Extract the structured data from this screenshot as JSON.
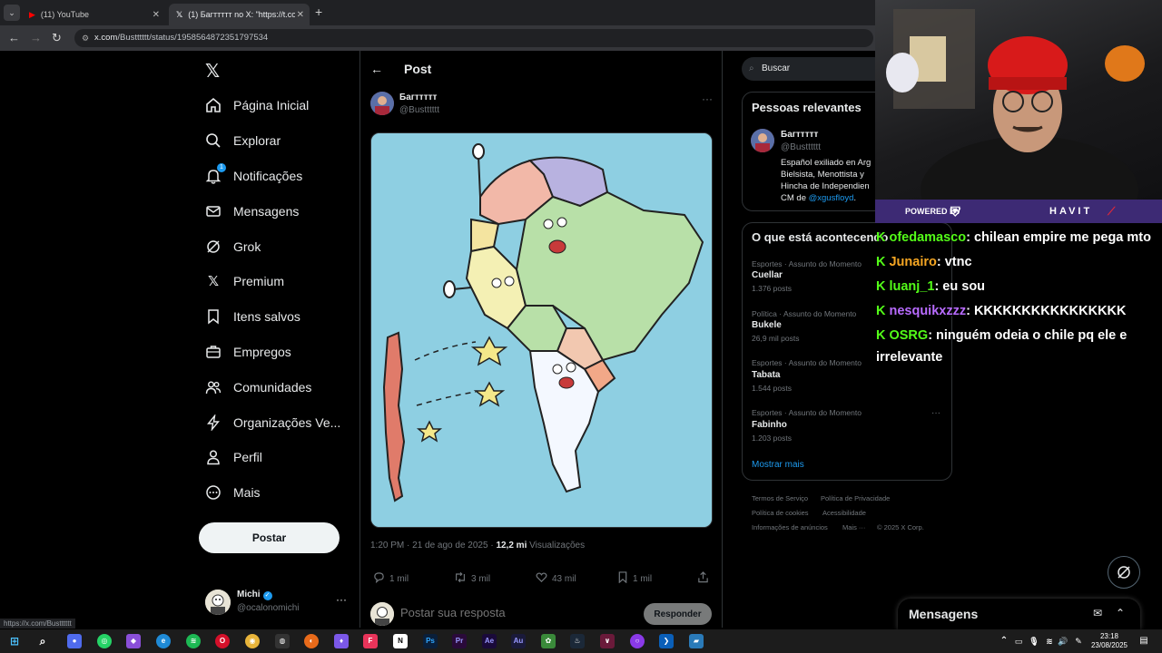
{
  "browser": {
    "tabs": [
      {
        "label": "(11) YouTube"
      },
      {
        "label": "(1) Багттттт no X: \"https://t.co/a"
      }
    ],
    "url_domain": "x.com",
    "url_path": "/Bustttttt/status/1958564872351797534",
    "status_url": "https://x.com/Bustttttt"
  },
  "nav": {
    "items": [
      {
        "label": "Página Inicial",
        "icon": "home-icon"
      },
      {
        "label": "Explorar",
        "icon": "search-icon"
      },
      {
        "label": "Notificações",
        "icon": "bell-icon",
        "badge": "1"
      },
      {
        "label": "Mensagens",
        "icon": "mail-icon"
      },
      {
        "label": "Grok",
        "icon": "grok-icon"
      },
      {
        "label": "Premium",
        "icon": "x-icon"
      },
      {
        "label": "Itens salvos",
        "icon": "bookmark-icon"
      },
      {
        "label": "Empregos",
        "icon": "briefcase-icon"
      },
      {
        "label": "Comunidades",
        "icon": "people-icon"
      },
      {
        "label": "Organizações Ve...",
        "icon": "bolt-icon"
      },
      {
        "label": "Perfil",
        "icon": "person-icon"
      },
      {
        "label": "Mais",
        "icon": "more-circle-icon"
      }
    ],
    "post_button": "Postar"
  },
  "account": {
    "name": "Michi",
    "handle": "@ocalonomichi"
  },
  "post": {
    "header_title": "Post",
    "author_name": "Багттттт",
    "author_handle": "@Bustttttt",
    "time": "1:20 PM · 21 de ago de 2025 · ",
    "views_count": "12,2 mi",
    "views_label": " Visualizações",
    "replies": "1 mil",
    "reposts": "3 mil",
    "likes": "43 mil",
    "bookmarks": "1 mil",
    "reply_placeholder": "Postar sua resposta",
    "reply_button": "Responder"
  },
  "sidebar": {
    "search_placeholder": "Buscar",
    "relevant_title": "Pessoas relevantes",
    "relevant_name": "Багттттт",
    "relevant_handle": "@Bustttttt",
    "relevant_bio": "Español exiliado en Arg\nBielsista, Menottista y\nHincha de Independien\nCM de ",
    "relevant_bio_link": "@xgusfloyd",
    "relevant_bio_end": ".",
    "trends_title": "O que está acontecendo",
    "trends": [
      {
        "category": "Esportes · Assunto do Momento",
        "name": "Cuellar",
        "count": "1.376 posts"
      },
      {
        "category": "Política · Assunto do Momento",
        "name": "Bukele",
        "count": "26,9 mil posts"
      },
      {
        "category": "Esportes · Assunto do Momento",
        "name": "Tabata",
        "count": "1.544 posts"
      },
      {
        "category": "Esportes · Assunto do Momento",
        "name": "Fabinho",
        "count": "1.203 posts"
      }
    ],
    "show_more": "Mostrar mais",
    "footer": [
      "Termos de Serviço",
      "Política de Privacidade",
      "Política de cookies",
      "Acessibilidade",
      "Informações de anúncios",
      "Mais ···",
      "© 2025 X Corp."
    ]
  },
  "stream": {
    "banner_powered": "POWERED BY",
    "banner_brand": "HAVIT",
    "chat": [
      {
        "user": "ofedamasco",
        "color": "#53fc18",
        "message": ": chilean empire me pega mto"
      },
      {
        "user": "Junairo",
        "color": "#f5a623",
        "message": ": vtnc"
      },
      {
        "user": "luanj_1",
        "color": "#53fc18",
        "message": ": eu sou"
      },
      {
        "user": "nesquikxzzz",
        "color": "#b86bff",
        "message": ": KKKKKKKKKKKKKKKK"
      },
      {
        "user": "OSRG",
        "color": "#53fc18",
        "message": ": ninguém odeia o chile pq ele e irrelevante"
      }
    ]
  },
  "messages_panel": {
    "title": "Mensagens"
  },
  "taskbar": {
    "time": "23:18",
    "date": "23/08/2025"
  },
  "colors": {
    "accent": "#1d9bf0",
    "chat_badge": "#53fc18"
  }
}
